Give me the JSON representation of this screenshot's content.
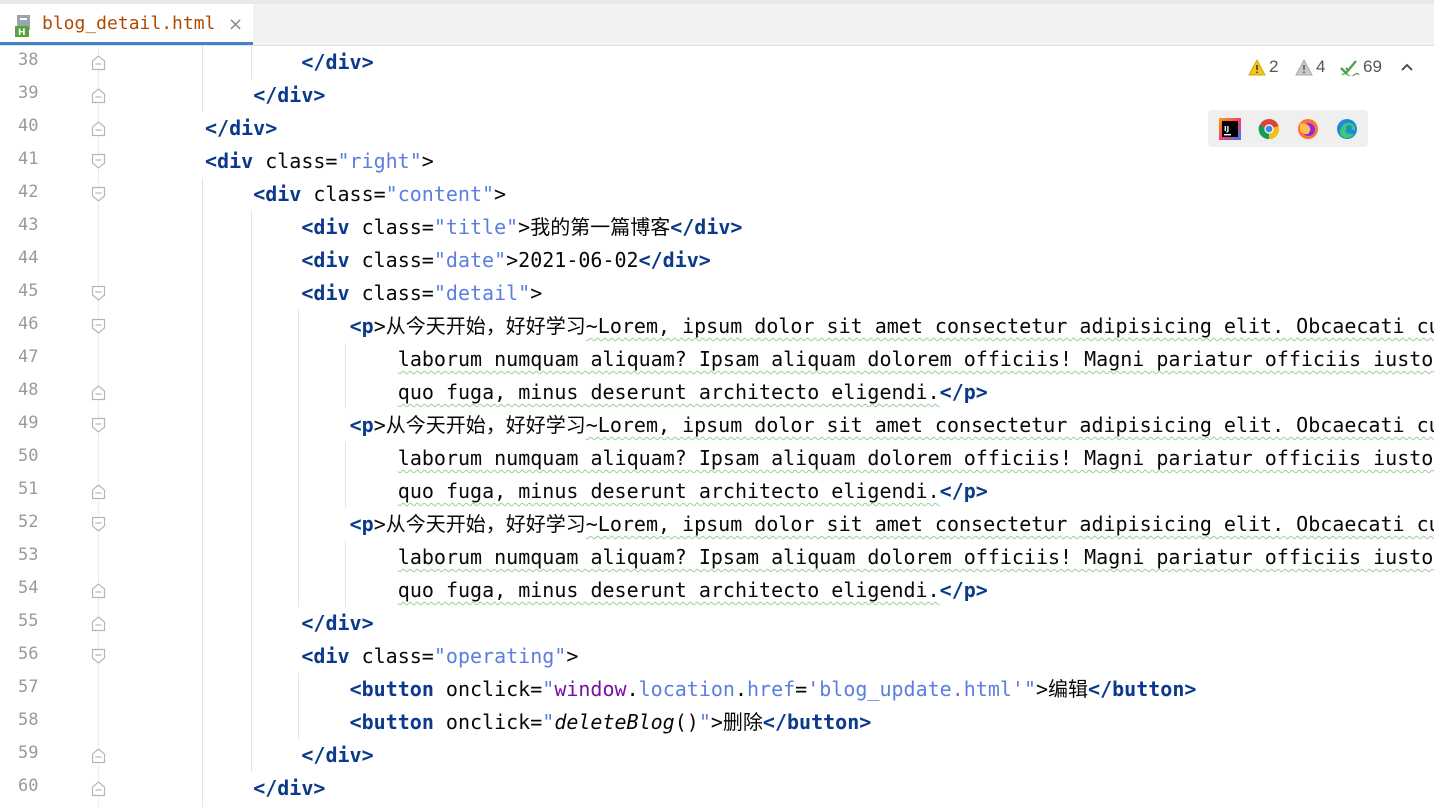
{
  "tab": {
    "filename": "blog_detail.html",
    "close_glyph": "×"
  },
  "indicators": {
    "warnings": "2",
    "weak_warnings": "4",
    "ok_count": "69"
  },
  "browsers": [
    "intellij-icon",
    "chrome-icon",
    "firefox-icon",
    "edge-icon"
  ],
  "lines": [
    {
      "num": "38"
    },
    {
      "num": "39"
    },
    {
      "num": "40"
    },
    {
      "num": "41"
    },
    {
      "num": "42"
    },
    {
      "num": "43"
    },
    {
      "num": "44"
    },
    {
      "num": "45"
    },
    {
      "num": "46"
    },
    {
      "num": "47"
    },
    {
      "num": "48"
    },
    {
      "num": "49"
    },
    {
      "num": "50"
    },
    {
      "num": "51"
    },
    {
      "num": "52"
    },
    {
      "num": "53"
    },
    {
      "num": "54"
    },
    {
      "num": "55"
    },
    {
      "num": "56"
    },
    {
      "num": "57"
    },
    {
      "num": "58"
    },
    {
      "num": "59"
    },
    {
      "num": "60"
    }
  ],
  "code": {
    "close_div": "</div>",
    "div_open": "<div",
    "gt": ">",
    "class_eq": " class=",
    "class_right": "\"right\"",
    "class_content": "\"content\"",
    "class_title": "\"title\"",
    "class_date": "\"date\"",
    "class_detail": "\"detail\"",
    "class_operating": "\"operating\"",
    "title_text": "我的第一篇博客",
    "date_text": "2021-06-02",
    "p_open": "<p",
    "p_close": "</p>",
    "p_cn": "从今天开始，好好学习",
    "p_line1": "~Lorem, ipsum dolor sit amet consectetur adipisicing elit. Obcaecati cum",
    "p_line2": "laborum numquam aliquam? Ipsam aliquam dolorem officiis! Magni pariatur officiis iusto?",
    "p_line3": "quo fuga, minus deserunt architecto eligendi.",
    "button_open": "<button",
    "button_close": "</button>",
    "onclick_eq": " onclick=",
    "js_window": "window",
    "js_location": "location",
    "js_href": "href",
    "js_dot": ".",
    "js_eq": "=",
    "js_url": "'blog_update.html'",
    "quote": "\"",
    "btn_edit": "编辑",
    "js_delete": "deleteBlog",
    "js_parens": "()",
    "btn_delete": "删除"
  }
}
